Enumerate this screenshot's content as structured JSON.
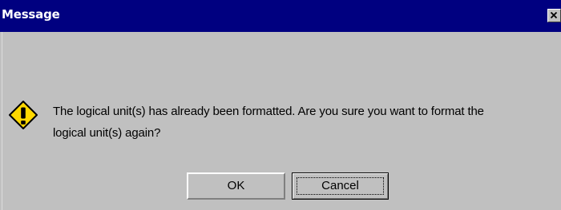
{
  "window": {
    "title": "Message",
    "title_bar_color": "#000080",
    "background_color": "#c0c0c0"
  },
  "titlebar": {
    "close_icon": "close-icon"
  },
  "dialog": {
    "icon": "warning-icon",
    "message_line1": "The logical unit(s) has already been formatted. Are you sure you want to format the",
    "message_line2": "logical unit(s) again?"
  },
  "buttons": {
    "ok_label": "OK",
    "cancel_label": "Cancel",
    "focused": "Cancel"
  }
}
